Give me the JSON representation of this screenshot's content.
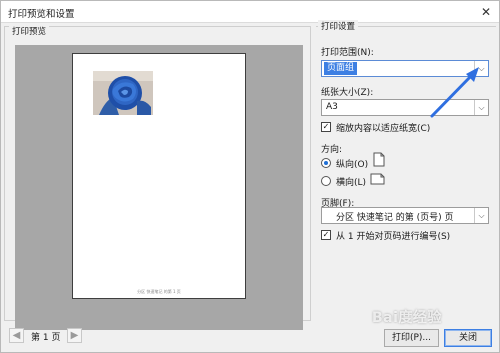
{
  "window": {
    "title": "打印预览和设置",
    "close_glyph": "✕"
  },
  "preview": {
    "group_label": "打印预览",
    "footer_text": "分区 快速笔记 的第 1 页",
    "nav": {
      "prev_glyph": "◀",
      "next_glyph": "▶",
      "page_label": "第 1 页"
    }
  },
  "settings": {
    "group_label": "打印设置",
    "print_range": {
      "label": "打印范围(N):",
      "value": "页面组"
    },
    "paper_size": {
      "label": "纸张大小(Z):",
      "value": "A3"
    },
    "fit_width": {
      "label": "缩放内容以适应纸宽(C)",
      "checked": true
    },
    "orientation": {
      "label": "方向:",
      "portrait_label": "纵向(O)",
      "landscape_label": "横向(L)",
      "selected": "portrait"
    },
    "footer": {
      "label": "页脚(F):",
      "value": "分区 快速笔记 的第 (页号) 页"
    },
    "start_numbering": {
      "label": "从 1 开始对页码进行编号(S)",
      "checked": true
    }
  },
  "buttons": {
    "print": "打印(P)...",
    "close": "关闭"
  },
  "overlay": {
    "watermark": "Bai度经验",
    "arrow_color": "#2f6fe0"
  },
  "icons": {
    "dropdown": "chevron-down-icon",
    "check": "✓"
  },
  "colors": {
    "accent": "#3d7fe3",
    "preview_bg": "#a7a7a7"
  }
}
